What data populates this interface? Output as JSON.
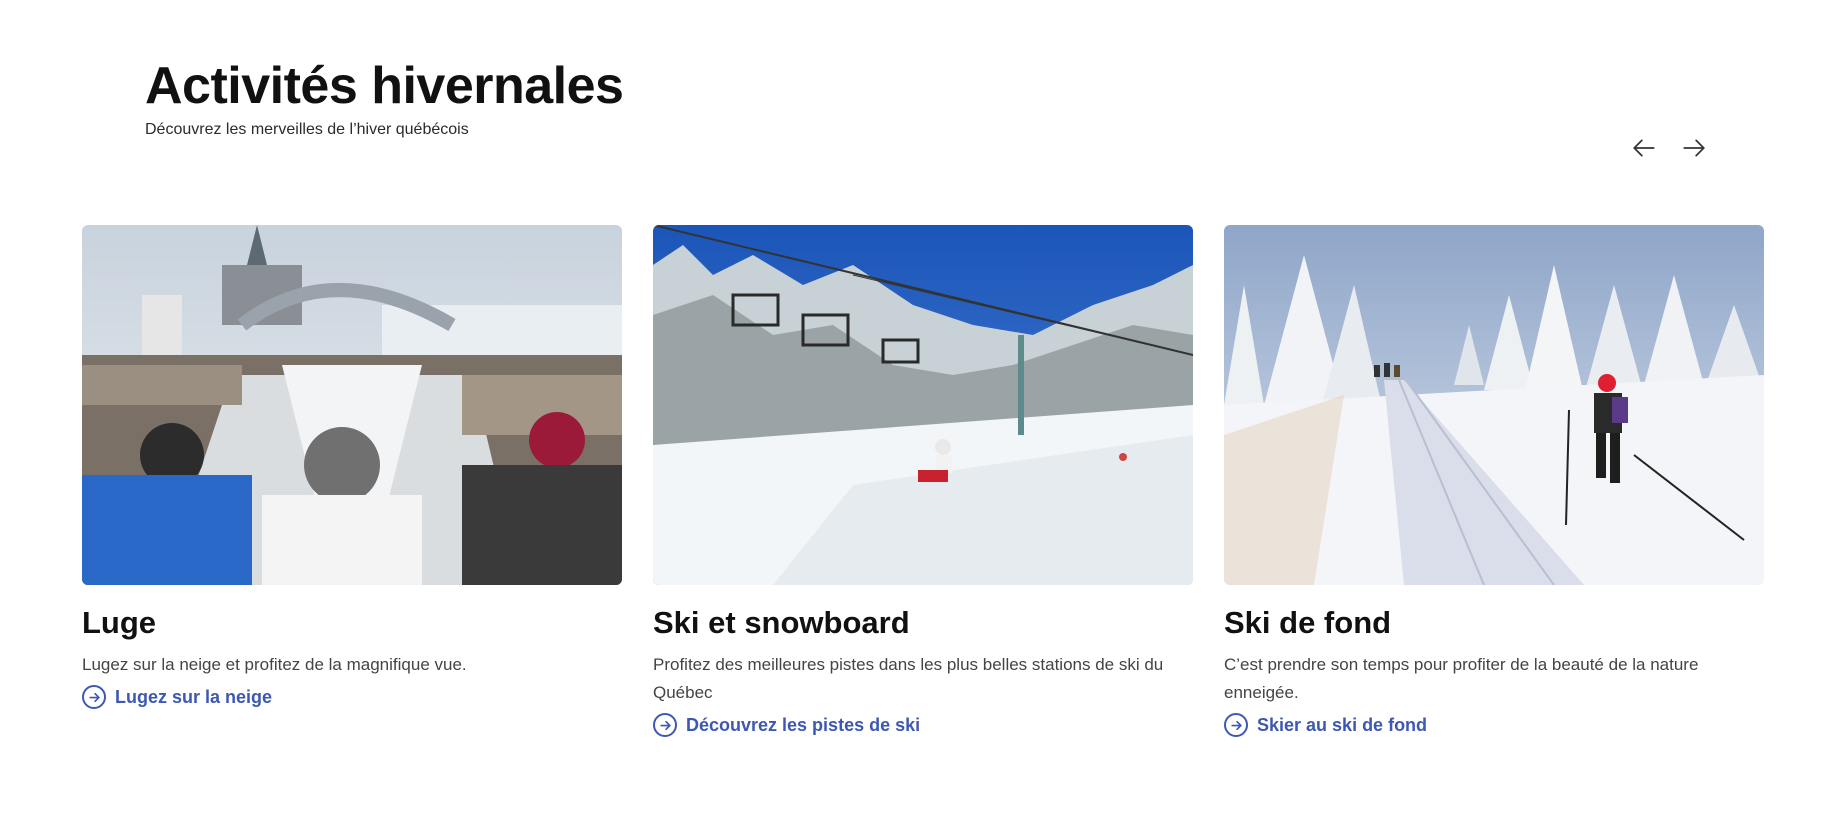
{
  "header": {
    "title": "Activités hivernales",
    "subtitle": "Découvrez les merveilles de l’hiver québécois"
  },
  "nav": {
    "prev_icon": "arrow-left-icon",
    "next_icon": "arrow-right-icon"
  },
  "colors": {
    "link": "#3d58b3",
    "title": "#111111",
    "text": "#444444"
  },
  "cards": [
    {
      "title": "Luge",
      "description": "Lugez sur la neige et profitez de la magnifique vue.",
      "link_label": "Lugez sur la neige",
      "link_icon": "arrow-circle-right-icon"
    },
    {
      "title": "Ski et snowboard",
      "description": "Profitez des meilleures pistes dans les plus belles stations de ski du Québec",
      "link_label": "Découvrez les pistes de ski",
      "link_icon": "arrow-circle-right-icon"
    },
    {
      "title": "Ski de fond",
      "description": "C’est prendre son temps pour profiter de la beauté de la nature enneigée.",
      "link_label": "Skier au ski de fond",
      "link_icon": "arrow-circle-right-icon"
    }
  ]
}
